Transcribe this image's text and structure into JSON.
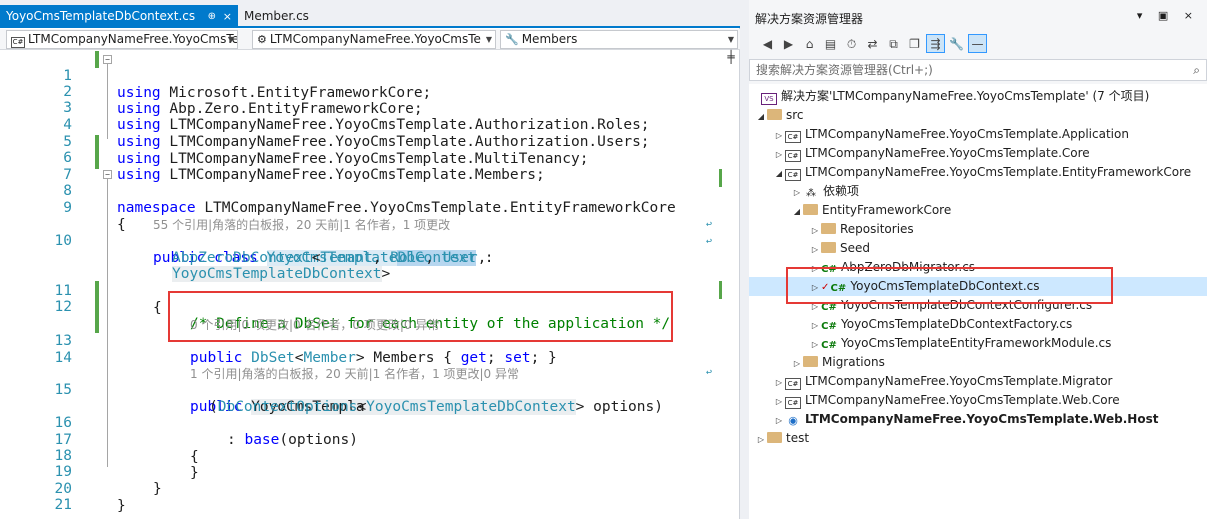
{
  "editor": {
    "tabs": [
      {
        "label": "YoyoCmsTemplateDbContext.cs",
        "pin": "⊕",
        "close": "×"
      },
      {
        "label": "Member.cs"
      }
    ],
    "nav": {
      "project": "LTMCompanyNameFree.YoyoCmsTe",
      "type": "LTMCompanyNameFree.YoyoCmsTe",
      "member": "Members"
    },
    "line_numbers": [
      "1",
      "2",
      "3",
      "4",
      "5",
      "6",
      "7",
      "8",
      "9",
      "10",
      "11",
      "12",
      "13",
      "14",
      "15",
      "16",
      "17",
      "18",
      "19",
      "20",
      "21"
    ],
    "code": {
      "l1": "Microsoft.EntityFrameworkCore;",
      "l2": "Abp.Zero.EntityFrameworkCore;",
      "l3": "LTMCompanyNameFree.YoyoCmsTemplate.Authorization.Roles;",
      "l4": "LTMCompanyNameFree.YoyoCmsTemplate.Authorization.Users;",
      "l5": "LTMCompanyNameFree.YoyoCmsTemplate.MultiTenancy;",
      "l6": "LTMCompanyNameFree.YoyoCmsTemplate.Members;",
      "kw_using": "using",
      "kw_namespace": "namespace",
      "namespace_name": "LTMCompanyNameFree.YoyoCmsTemplate.EntityFrameworkCore",
      "brace_open": "{",
      "brace_close": "}",
      "lens1": "55 个引用|角落的白板报，20 天前|1 名作者，1 项更改",
      "kw_public": "public",
      "kw_class": "class",
      "class_name_a": "YoyoCmsTemplate",
      "class_name_b": "DbContext",
      "colon": ":",
      "base_class": "AbpZeroDbContext",
      "lt": "<",
      "gt": ">",
      "gt_comma": ">,",
      "tenant": "Tenant",
      "role": "Role",
      "user": "User",
      "comma": ",",
      "class_name_full": "YoyoCmsTemplateDbContext",
      "comment": "/* Define a DbSet for each entity of the application */",
      "lens2": "0 个引用|0 项更改|0 名作者，0 项更改|0 异常",
      "dbset": "DbSet",
      "member": "Member",
      "members_prop": "Members { ",
      "kw_get": "get",
      "kw_set": "set",
      "semi_space": "; ",
      "prop_end": "; }",
      "lens3": "1 个引用|角落的白板报，20 天前|1 名作者，1 项更改|0 异常",
      "ctor_name": "YoyoCmsTemplateDbContext",
      "open_paren": "(",
      "options_type": "DbContextOptions",
      "options_tail": " options)",
      "kw_base": "base",
      "base_args": "(options)"
    }
  },
  "solution_explorer": {
    "title": "解决方案资源管理器",
    "title_buttons": "▾ ▣ ×",
    "search_placeholder": "搜索解决方案资源管理器(Ctrl+;)",
    "search_icon": "⌕",
    "items": [
      {
        "label": "解决方案'LTMCompanyNameFree.YoyoCmsTemplate' (7 个项目)",
        "icon": "solution-icon"
      },
      {
        "label": "src",
        "icon": "folder-icon"
      },
      {
        "label": "LTMCompanyNameFree.YoyoCmsTemplate.Application",
        "icon": "csproj-icon"
      },
      {
        "label": "LTMCompanyNameFree.YoyoCmsTemplate.Core",
        "icon": "csproj-icon"
      },
      {
        "label": "LTMCompanyNameFree.YoyoCmsTemplate.EntityFrameworkCore",
        "icon": "csproj-icon"
      },
      {
        "label": "依赖项",
        "icon": "dependencies-icon"
      },
      {
        "label": "EntityFrameworkCore",
        "icon": "folder-icon"
      },
      {
        "label": "Repositories",
        "icon": "folder-icon"
      },
      {
        "label": "Seed",
        "icon": "folder-icon"
      },
      {
        "label": "AbpZeroDbMigrator.cs",
        "icon": "csharp-file-icon"
      },
      {
        "label": "YoyoCmsTemplateDbContext.cs",
        "icon": "csharp-file-icon"
      },
      {
        "label": "YoyoCmsTemplateDbContextConfigurer.cs",
        "icon": "csharp-file-icon"
      },
      {
        "label": "YoyoCmsTemplateDbContextFactory.cs",
        "icon": "csharp-file-icon"
      },
      {
        "label": "YoyoCmsTemplateEntityFrameworkModule.cs",
        "icon": "csharp-file-icon"
      },
      {
        "label": "Migrations",
        "icon": "folder-icon"
      },
      {
        "label": "LTMCompanyNameFree.YoyoCmsTemplate.Migrator",
        "icon": "csproj-icon"
      },
      {
        "label": "LTMCompanyNameFree.YoyoCmsTemplate.Web.Core",
        "icon": "csproj-icon"
      },
      {
        "label": "LTMCompanyNameFree.YoyoCmsTemplate.Web.Host",
        "icon": "web-project-icon"
      },
      {
        "label": "test",
        "icon": "folder-icon"
      }
    ]
  },
  "colors": {
    "accent": "#007acc",
    "keyword": "#0000ff",
    "type": "#2b91af",
    "comment": "#008000",
    "annotation_box": "#e53935"
  }
}
